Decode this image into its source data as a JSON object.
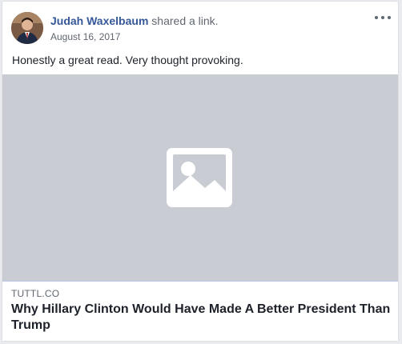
{
  "post": {
    "author": "Judah Waxelbaum",
    "action": "shared a link.",
    "date": "August 16, 2017",
    "text": "Honestly a great read. Very thought provoking.",
    "more_icon": "more-options-icon"
  },
  "link": {
    "domain": "TUTTL.CO",
    "title": "Why Hillary Clinton Would Have Made A Better President Than Trump",
    "image_icon": "image-placeholder-icon"
  },
  "colors": {
    "author_link": "#365899",
    "image_placeholder_bg": "#c9ccd3"
  }
}
